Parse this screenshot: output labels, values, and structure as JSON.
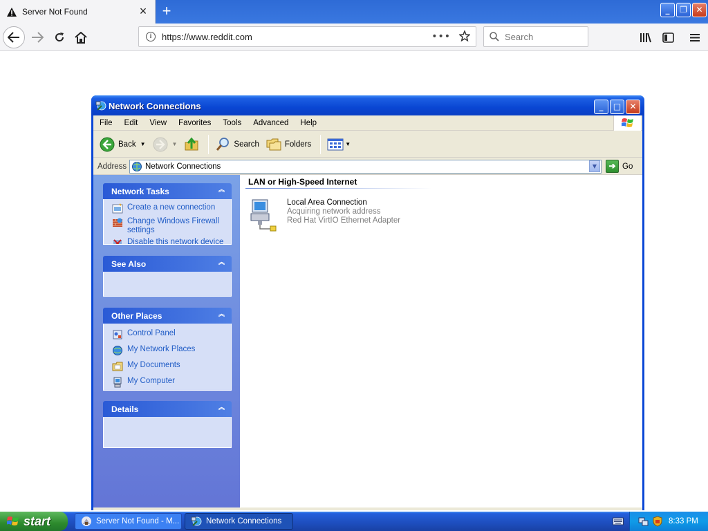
{
  "browser": {
    "tab_title": "Server Not Found",
    "url": "https://www.reddit.com",
    "search_placeholder": "Search"
  },
  "window": {
    "title": "Network Connections",
    "menu": [
      "File",
      "Edit",
      "View",
      "Favorites",
      "Tools",
      "Advanced",
      "Help"
    ],
    "toolbar": {
      "back": "Back",
      "search": "Search",
      "folders": "Folders"
    },
    "address": {
      "label": "Address",
      "value": "Network Connections",
      "go": "Go"
    }
  },
  "sidebar": {
    "network_tasks": {
      "title": "Network Tasks",
      "items": [
        "Create a new connection",
        "Change Windows Firewall settings",
        "Disable this network device"
      ]
    },
    "see_also": {
      "title": "See Also"
    },
    "other_places": {
      "title": "Other Places",
      "items": [
        "Control Panel",
        "My Network Places",
        "My Documents",
        "My Computer"
      ]
    },
    "details": {
      "title": "Details"
    }
  },
  "content": {
    "group_title": "LAN or High-Speed Internet",
    "connection": {
      "name": "Local Area Connection",
      "status": "Acquiring network address",
      "adapter": "Red Hat VirtIO Ethernet Adapter"
    }
  },
  "taskbar": {
    "start": "start",
    "items": [
      "Server Not Found - M...",
      "Network Connections"
    ],
    "time": "8:33 PM"
  }
}
